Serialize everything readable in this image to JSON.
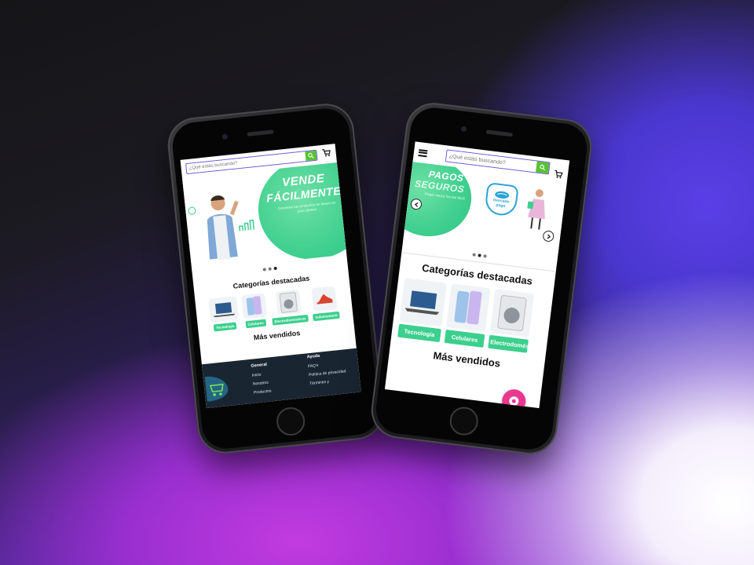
{
  "search": {
    "placeholder": "¿Qué estás buscando?"
  },
  "left": {
    "hero_title_1": "VENDE",
    "hero_title_2": "FÁCILMENTE",
    "hero_sub": "Convierte tus productos en dinero en poco tiempo",
    "section_title": "Categorías destacadas",
    "best_sellers": "Más vendidos",
    "categories": [
      "Tecnología",
      "Celulares",
      "Electrodomésticos",
      "Indumentaria"
    ],
    "footer": {
      "col1_title": "General",
      "col1_links": [
        "Inicio",
        "Nosotros",
        "Productos"
      ],
      "col2_title": "Ayuda",
      "col2_links": [
        "FAQ's",
        "Política de privacidad",
        "Términos y"
      ]
    }
  },
  "right": {
    "hero_title_1": "PAGOS",
    "hero_title_2": "SEGUROS",
    "hero_sub": "Pagar nunca fue tan fácil!",
    "badge_line1": "mercado",
    "badge_line2": "pago",
    "section_title": "Categorías destacadas",
    "best_sellers": "Más vendidos",
    "categories": [
      "Tecnología",
      "Celulares",
      "Electrodomésticos"
    ]
  },
  "colors": {
    "accent": "#3ccf8e",
    "search": "#59c232",
    "footer": "#192632",
    "fab": "#e9368f"
  }
}
